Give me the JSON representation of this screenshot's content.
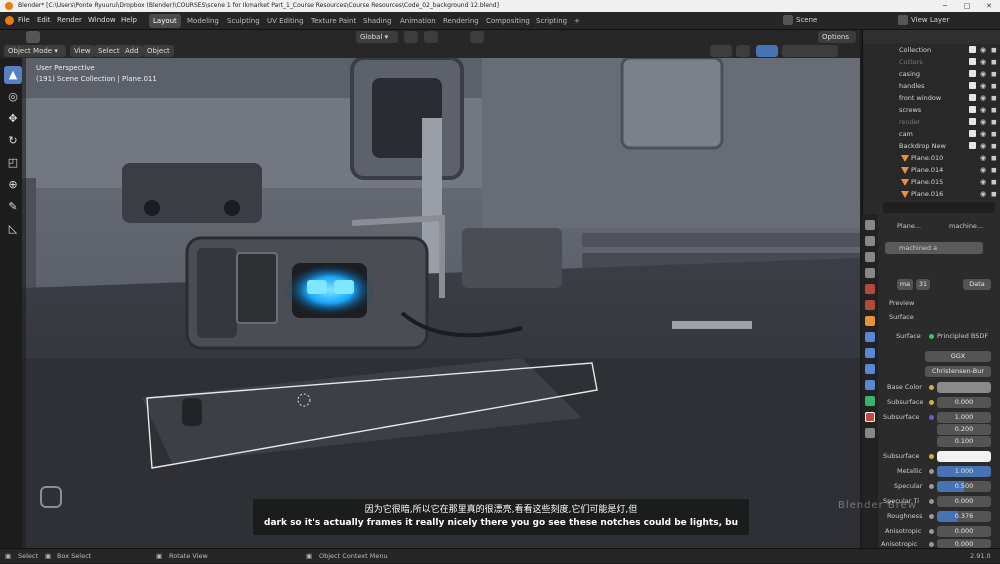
{
  "titlebar": {
    "text": "Blender* [C:\\Users\\Ponte Ryuurui\\Dropbox (Blender)\\COURSES\\scene 1 for Ikmarket Part_1_Course Resources\\Course Resources\\Code_02_background 12.blend]",
    "minimize": "─",
    "maximize": "□",
    "close": "✕"
  },
  "menu": [
    "File",
    "Edit",
    "Render",
    "Window",
    "Help"
  ],
  "workspaces": [
    "Layout",
    "Modeling",
    "Sculpting",
    "UV Editing",
    "Texture Paint",
    "Shading",
    "Animation",
    "Rendering",
    "Compositing",
    "Scripting",
    "+"
  ],
  "scene": {
    "label": "Scene",
    "view_layer": "View Layer"
  },
  "viewport_header": {
    "mode": "Object Mode",
    "view": "View",
    "select": "Select",
    "add": "Add",
    "object": "Object",
    "transform": "Global",
    "options": "Options"
  },
  "viewport": {
    "perspective": "User Perspective",
    "collection": "(191) Scene Collection | Plane.011"
  },
  "outliner": {
    "rows": [
      {
        "name": "Collection",
        "dim": false
      },
      {
        "name": "Cutters",
        "dim": true
      },
      {
        "name": "casing",
        "dim": false
      },
      {
        "name": "handles",
        "dim": false
      },
      {
        "name": "front window",
        "dim": false
      },
      {
        "name": "screws",
        "dim": false
      },
      {
        "name": "render",
        "dim": true
      },
      {
        "name": "cam",
        "dim": false
      },
      {
        "name": "Backdrop New",
        "dim": false
      },
      {
        "name": "Plane.010",
        "dim": false
      },
      {
        "name": "Plane.014",
        "dim": false
      },
      {
        "name": "Plane.015",
        "dim": false
      },
      {
        "name": "Plane.016",
        "dim": false
      }
    ]
  },
  "properties": {
    "object_name": "Plane...",
    "material_name": "machine...",
    "slot": "machined a",
    "mat_field": "ma",
    "users": "31",
    "data": "Data",
    "preview": "Preview",
    "surface_panel": "Surface",
    "surface_label": "Surface",
    "surface_value": "Principled BSDF",
    "distribution": "GGX",
    "subsurface_method": "Christensen-Bur",
    "fields": [
      {
        "label": "Base Color",
        "value": ""
      },
      {
        "label": "Subsurface",
        "value": "0.000"
      },
      {
        "label": "Subsurface",
        "value": "1.000"
      },
      {
        "label": "",
        "value": "0.200"
      },
      {
        "label": "",
        "value": "0.100"
      },
      {
        "label": "Subsurface",
        "value": ""
      },
      {
        "label": "Metallic",
        "value": "1.000"
      },
      {
        "label": "Specular",
        "value": "0.500"
      },
      {
        "label": "Specular Ti",
        "value": "0.000"
      },
      {
        "label": "Roughness",
        "value": "0.376"
      },
      {
        "label": "Anisotropic",
        "value": "0.000"
      },
      {
        "label": "Anisotropic",
        "value": "0.000"
      }
    ]
  },
  "statusbar": {
    "select": "Select",
    "box_select": "Box Select",
    "rotate": "Rotate View",
    "context": "Object Context Menu",
    "version": "2.91.0"
  },
  "subtitle": {
    "cn": "因为它很暗,所以它在那里真的很漂亮,看看这些刻度,它们可能是灯,但",
    "en": "dark so it's actually frames it really nicely there you go see these notches could be lights, bu"
  },
  "watermark": "Blender Brew"
}
